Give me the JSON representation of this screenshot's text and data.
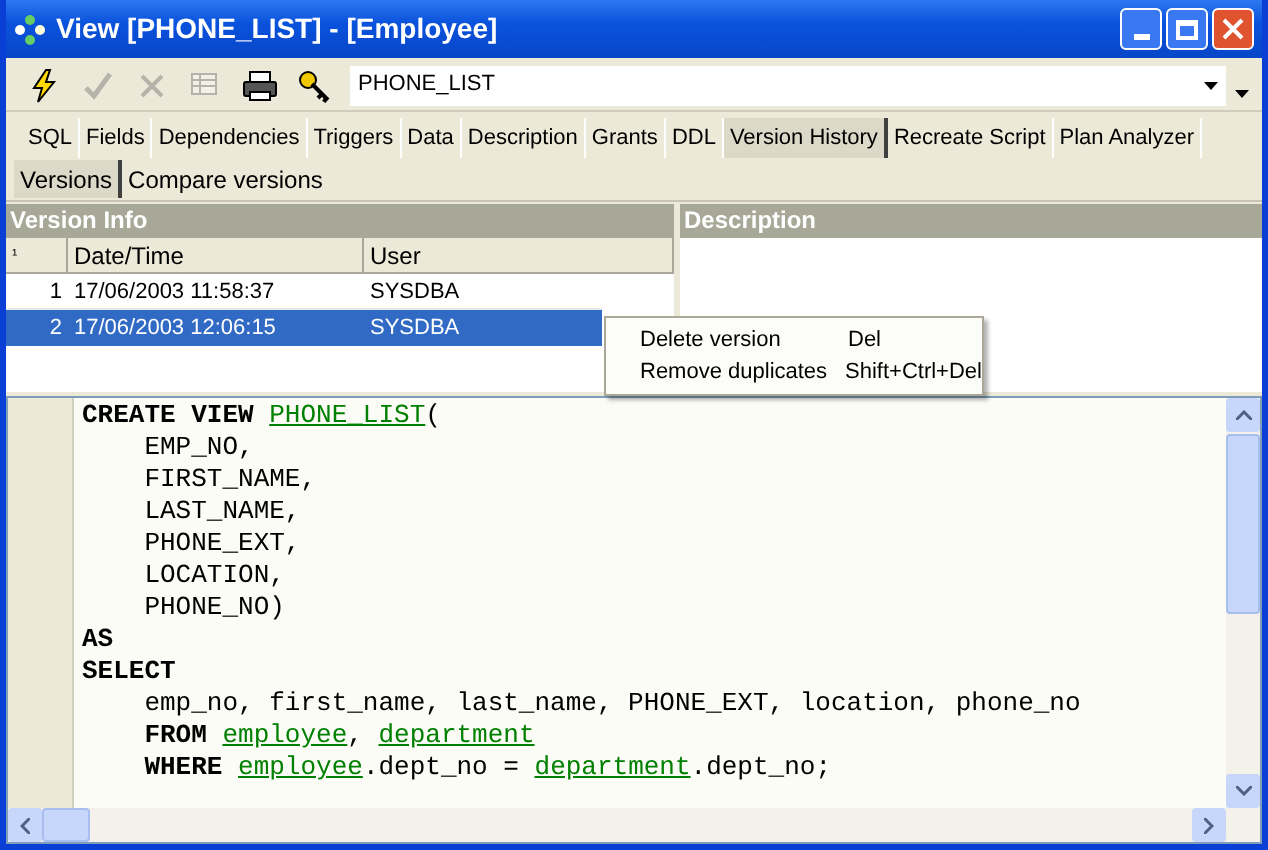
{
  "window": {
    "title": "View [PHONE_LIST] - [Employee]"
  },
  "toolbar": {
    "object_name": "PHONE_LIST"
  },
  "tabs": [
    {
      "label": "SQL",
      "selected": false
    },
    {
      "label": "Fields",
      "selected": false
    },
    {
      "label": "Dependencies",
      "selected": false
    },
    {
      "label": "Triggers",
      "selected": false
    },
    {
      "label": "Data",
      "selected": false
    },
    {
      "label": "Description",
      "selected": false
    },
    {
      "label": "Grants",
      "selected": false
    },
    {
      "label": "DDL",
      "selected": false
    },
    {
      "label": "Version History",
      "selected": true
    },
    {
      "label": "Recreate Script",
      "selected": false
    },
    {
      "label": "Plan Analyzer",
      "selected": false
    }
  ],
  "subtabs": [
    {
      "label": "Versions",
      "selected": true
    },
    {
      "label": "Compare versions",
      "selected": false
    }
  ],
  "version_info": {
    "title": "Version Info",
    "columns": [
      "¹",
      "Date/Time",
      "User"
    ],
    "rows": [
      {
        "cells": [
          "1",
          "17/06/2003 11:58:37",
          "SYSDBA"
        ],
        "selected": false
      },
      {
        "cells": [
          "2",
          "17/06/2003 12:06:15",
          "SYSDBA"
        ],
        "selected": true
      }
    ]
  },
  "description": {
    "title": "Description"
  },
  "context_menu": [
    {
      "label": "Delete version",
      "shortcut": "Del"
    },
    {
      "label": "Remove duplicates",
      "shortcut": "Shift+Ctrl+Del"
    }
  ],
  "code": [
    [
      {
        "kind": "kw",
        "text": "CREATE VIEW "
      },
      {
        "kind": "ident",
        "text": "PHONE_LIST"
      },
      {
        "kind": "plain",
        "text": "("
      }
    ],
    [
      {
        "kind": "plain",
        "text": "    EMP_NO,"
      }
    ],
    [
      {
        "kind": "plain",
        "text": "    FIRST_NAME,"
      }
    ],
    [
      {
        "kind": "plain",
        "text": "    LAST_NAME,"
      }
    ],
    [
      {
        "kind": "plain",
        "text": "    PHONE_EXT,"
      }
    ],
    [
      {
        "kind": "plain",
        "text": "    LOCATION,"
      }
    ],
    [
      {
        "kind": "plain",
        "text": "    PHONE_NO)"
      }
    ],
    [
      {
        "kind": "kw",
        "text": "AS"
      }
    ],
    [
      {
        "kind": "kw",
        "text": "SELECT"
      }
    ],
    [
      {
        "kind": "plain",
        "text": "    emp_no, first_name, last_name, PHONE_EXT, location, phone_no"
      }
    ],
    [
      {
        "kind": "kw",
        "text": "    FROM "
      },
      {
        "kind": "ident",
        "text": "employee"
      },
      {
        "kind": "plain",
        "text": ", "
      },
      {
        "kind": "ident",
        "text": "department"
      }
    ],
    [
      {
        "kind": "kw",
        "text": "    WHERE "
      },
      {
        "kind": "ident",
        "text": "employee"
      },
      {
        "kind": "plain",
        "text": ".dept_no = "
      },
      {
        "kind": "ident",
        "text": "department"
      },
      {
        "kind": "plain",
        "text": ".dept_no;"
      }
    ]
  ]
}
